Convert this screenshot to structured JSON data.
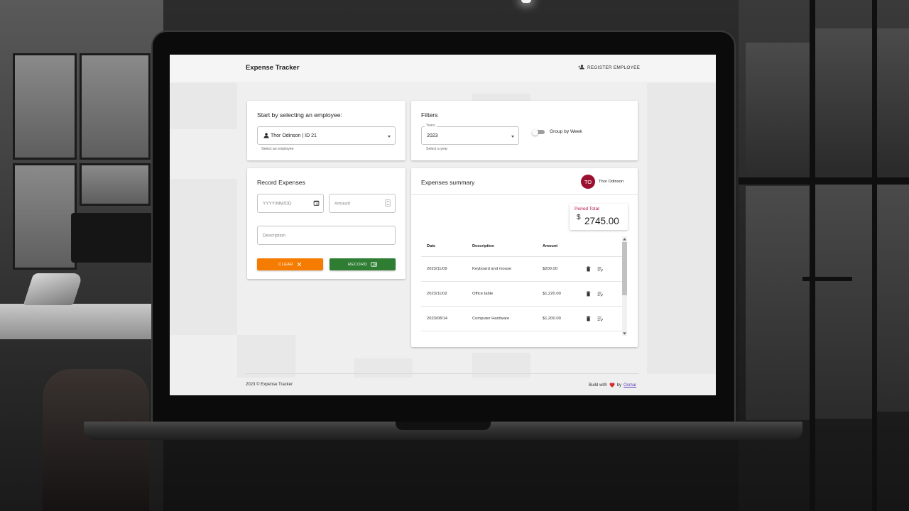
{
  "app": {
    "title": "Expense Tracker",
    "register_label": "REGISTER EMPLOYEE"
  },
  "employee_card": {
    "title": "Start by selecting an employee:",
    "selected_employee": "Thor Odinson | ID 21",
    "helper": "Select an employee"
  },
  "filters_card": {
    "title": "Filters",
    "year_label": "Years",
    "year_value": "2023",
    "year_helper": "Select a year",
    "group_by_week_label": "Group by Week",
    "group_by_week_enabled": false
  },
  "record_card": {
    "title": "Record Expenses",
    "date_placeholder": "YYYY/MM/DD",
    "amount_placeholder": "Amount",
    "description_placeholder": "Description",
    "clear_label": "CLEAR",
    "record_label": "RECORD"
  },
  "summary_card": {
    "title": "Expenses summary",
    "avatar_initials": "TO",
    "employee_name": "Thor Odinson",
    "period_total_label": "Period Total",
    "currency_symbol": "$",
    "period_total_value": "2745.00",
    "columns": [
      "Date",
      "Description",
      "Amount"
    ],
    "rows": [
      {
        "date": "2023/11/09",
        "description": "Keyboard and mouse",
        "amount": "$200.00"
      },
      {
        "date": "2023/11/02",
        "description": "Office table",
        "amount": "$1,220.00"
      },
      {
        "date": "2023/08/14",
        "description": "Computer Hardware",
        "amount": "$1,200.00"
      }
    ]
  },
  "footer": {
    "copyright": "2023 © Expense Tracker",
    "built_with_prefix": "Build with",
    "built_with_by": "by",
    "author": "Osmar"
  },
  "colors": {
    "clear_button": "#f57c00",
    "record_button": "#2e7d32",
    "avatar": "#9b1030",
    "period_total_label": "#b0124a",
    "heart": "#d32f2f"
  },
  "icons": [
    "add-person-icon",
    "person-icon",
    "calendar-icon",
    "stepper-icon",
    "close-icon",
    "receipt-icon",
    "trash-icon",
    "edit-list-icon",
    "heart-icon",
    "chevron-up-icon",
    "chevron-down-icon"
  ]
}
